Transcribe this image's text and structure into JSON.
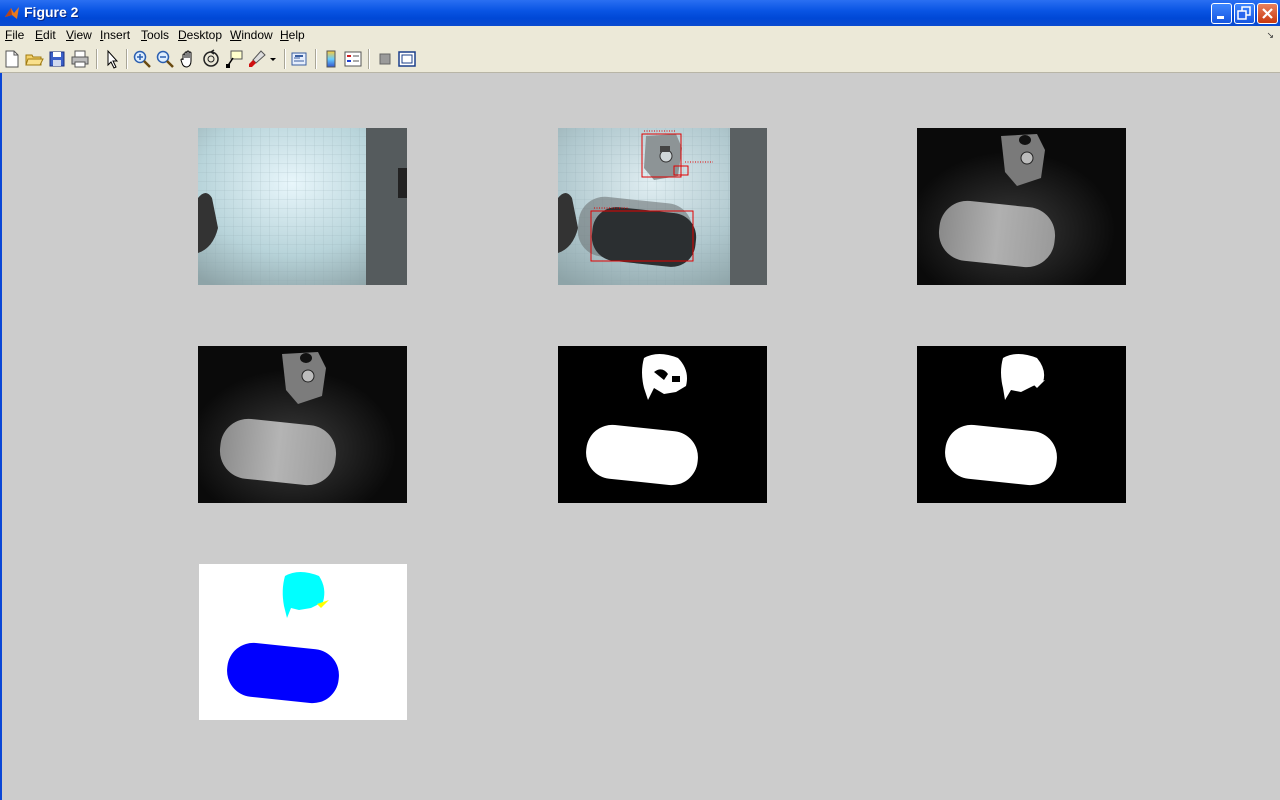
{
  "window": {
    "title": "Figure 2",
    "icon": "matlab-icon",
    "controls": [
      "minimize-icon",
      "restore-icon",
      "close-icon"
    ]
  },
  "menubar": {
    "items": [
      {
        "label": "File",
        "key": "F"
      },
      {
        "label": "Edit",
        "key": "E"
      },
      {
        "label": "View",
        "key": "V"
      },
      {
        "label": "Insert",
        "key": "I"
      },
      {
        "label": "Tools",
        "key": "T"
      },
      {
        "label": "Desktop",
        "key": "D"
      },
      {
        "label": "Window",
        "key": "W"
      },
      {
        "label": "Help",
        "key": "H"
      }
    ]
  },
  "toolbar": {
    "tools": [
      "new-figure-icon",
      "open-file-icon",
      "save-icon",
      "print-icon",
      "edit-plot-icon",
      "zoom-in-icon",
      "zoom-out-icon",
      "pan-icon",
      "rotate-3d-icon",
      "data-cursor-icon",
      "brush-icon",
      "link-plot-icon",
      "insert-colorbar-icon",
      "insert-legend-icon",
      "hide-plot-tools-icon",
      "show-plot-tools-icon"
    ]
  },
  "subplots": [
    {
      "name": "background-image",
      "content": "background grid scene"
    },
    {
      "name": "detection-overlay-image",
      "content": "scene with red bounding boxes"
    },
    {
      "name": "difference-image",
      "content": "grayscale difference"
    },
    {
      "name": "filtered-difference-image",
      "content": "grayscale filtered"
    },
    {
      "name": "binary-mask-image",
      "content": "thresholded binary mask"
    },
    {
      "name": "cleaned-mask-image",
      "content": "morphologically cleaned mask"
    },
    {
      "name": "labeled-regions-image",
      "content": "colored connected components"
    }
  ],
  "colors": {
    "titlebar": "#0a55e4",
    "menubar": "#ece9d8",
    "figure_bg": "#cccccc",
    "bbox": "#ff0000",
    "label_cyan": "#00ffff",
    "label_blue": "#0000ff",
    "label_yellow": "#ffff00"
  }
}
